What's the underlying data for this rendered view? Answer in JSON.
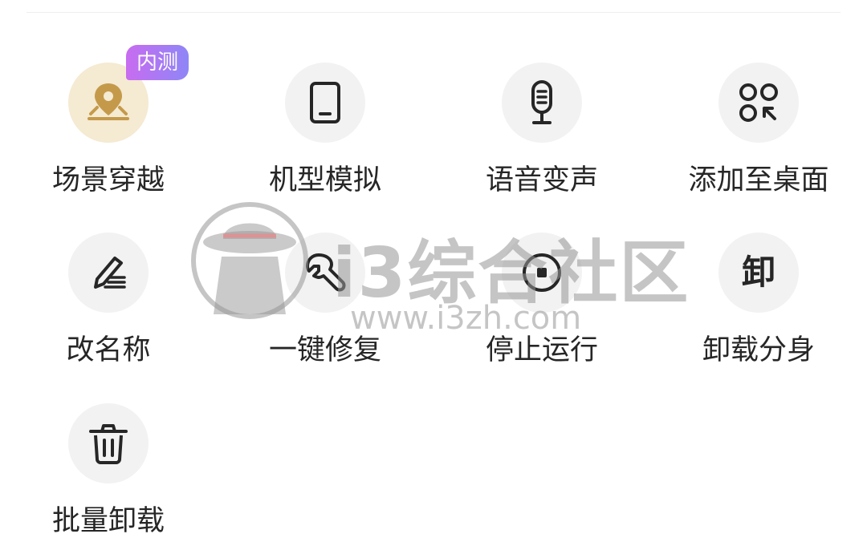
{
  "colors": {
    "icon_stroke": "#262626",
    "label_text": "#262626",
    "tile_bg": "#f2f2f2",
    "featured_tile_bg": "#f5ead2",
    "featured_icon": "#c49a4a",
    "badge_gradient_start": "#c86cf0",
    "badge_gradient_end": "#8e86f7"
  },
  "actions": [
    {
      "label": "场景穿越",
      "icon": "location-pin-icon",
      "badge": "内测"
    },
    {
      "label": "机型模拟",
      "icon": "phone-device-icon"
    },
    {
      "label": "语音变声",
      "icon": "microphone-icon"
    },
    {
      "label": "添加至桌面",
      "icon": "add-to-desktop-icon"
    },
    {
      "label": "改名称",
      "icon": "pen-edit-icon"
    },
    {
      "label": "一键修复",
      "icon": "wrench-icon"
    },
    {
      "label": "停止运行",
      "icon": "stop-icon"
    },
    {
      "label": "卸载分身",
      "icon": "uninstall-char-icon",
      "icon_text": "卸"
    },
    {
      "label": "批量卸载",
      "icon": "trash-icon"
    }
  ],
  "watermark": {
    "title": "i3综合社区",
    "url": "www.i3zh.com"
  }
}
